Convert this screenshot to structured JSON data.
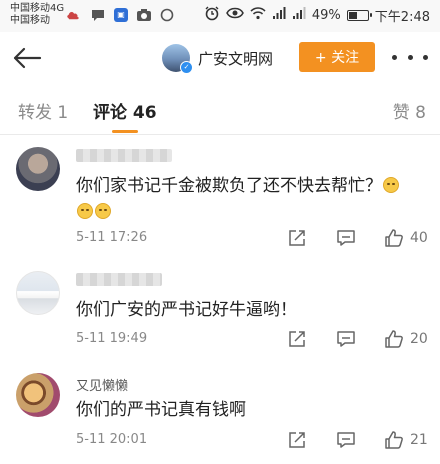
{
  "status_bar": {
    "carrier_line1": "中国移动4G",
    "carrier_line2": "中国移动",
    "battery": "49%",
    "battery_level": 0.49,
    "time": "下午2:48",
    "left_icons": [
      "weather-icon",
      "message-icon",
      "app-icon",
      "camera-icon",
      "circle-icon"
    ],
    "right_icons": [
      "alarm-icon",
      "eye-icon",
      "wifi-icon",
      "signal-icon",
      "signal-icon",
      "battery-icon"
    ]
  },
  "header": {
    "account_name": "广安文明网",
    "follow_label": "+ 关注",
    "follow_color": "#f39121"
  },
  "tabs": {
    "repost": "转发 1",
    "comment": "评论 46",
    "like": "赞 8",
    "accent": "#f39121"
  },
  "comments": [
    {
      "user": "",
      "text": "你们家书记千金被欺负了还不快去帮忙？",
      "emoji_count": 3,
      "time": "5-11 17:26",
      "likes": "40"
    },
    {
      "user": "",
      "text": "你们广安的严书记好牛逼哟！",
      "emoji_count": 0,
      "time": "5-11 19:49",
      "likes": "20"
    },
    {
      "user": "又见懒懒",
      "text": "你们的严书记真有钱啊",
      "emoji_count": 0,
      "time": "5-11 20:01",
      "likes": "21"
    }
  ]
}
